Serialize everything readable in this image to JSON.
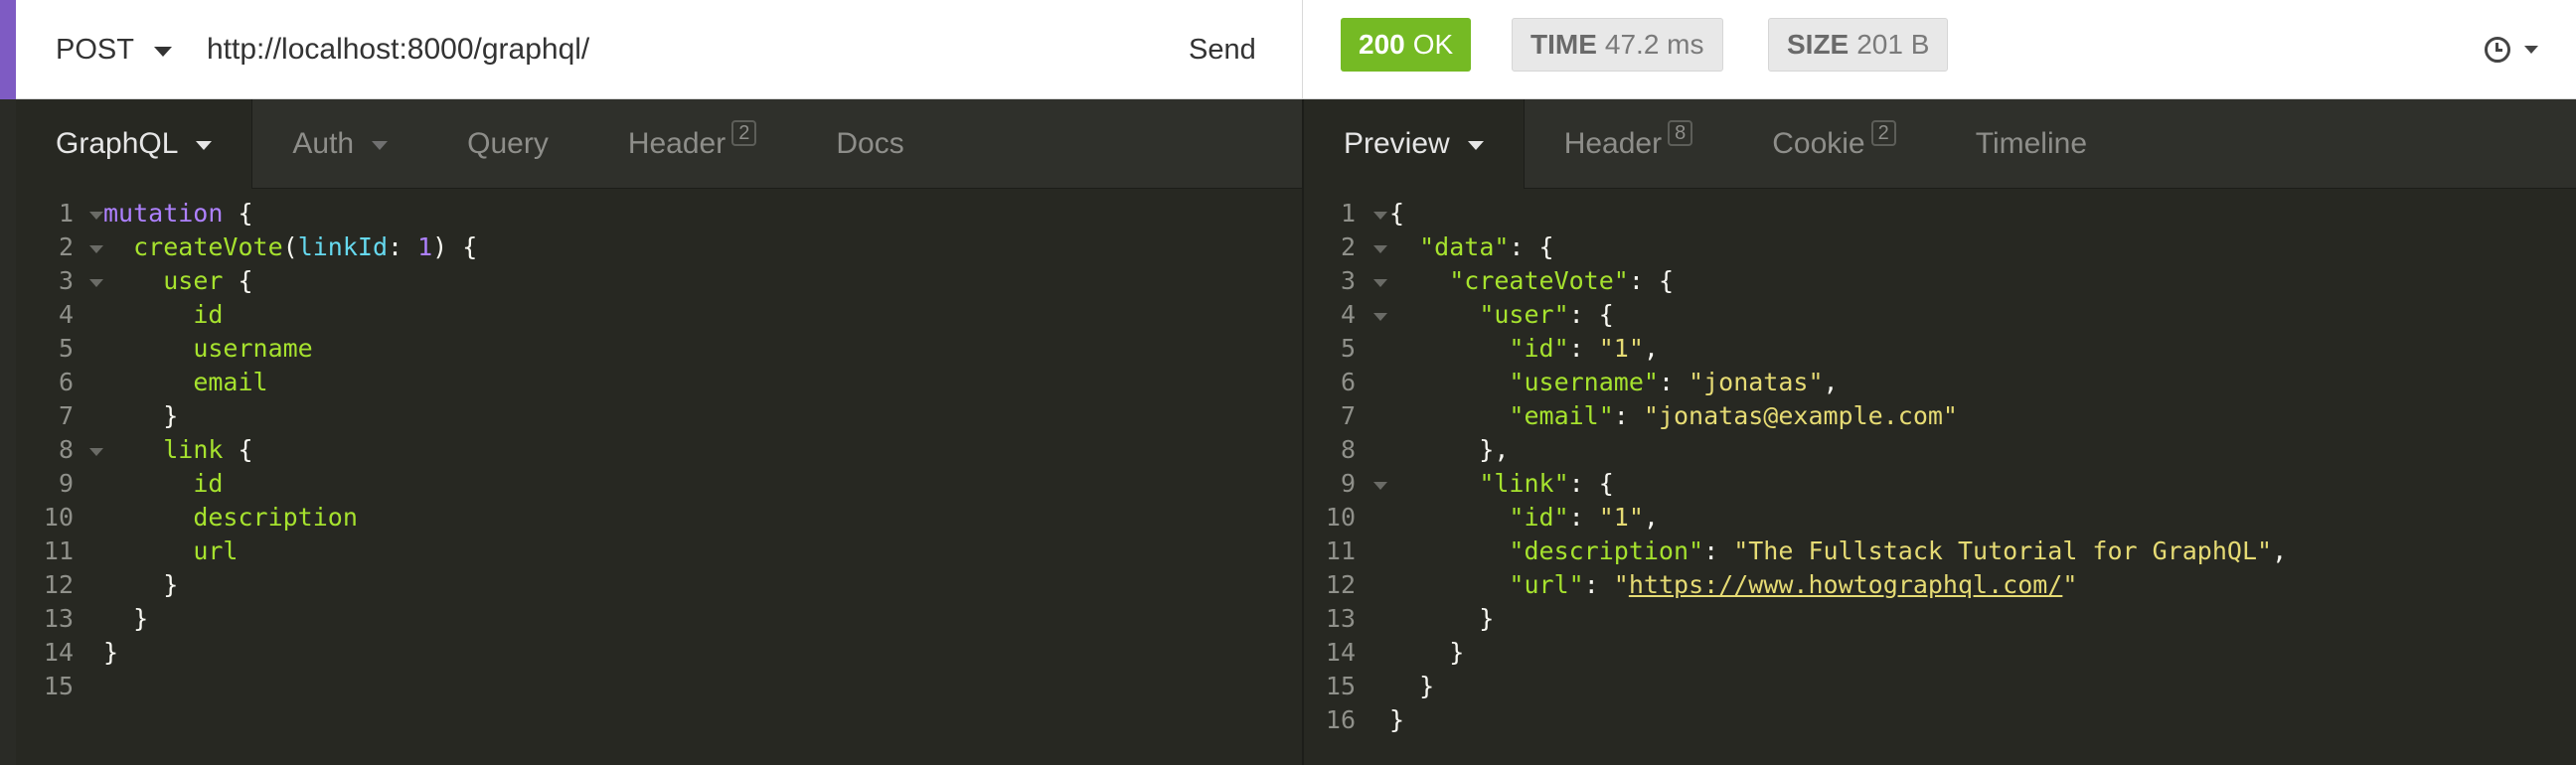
{
  "request": {
    "method": "POST",
    "url": "http://localhost:8000/graphql/",
    "send_label": "Send",
    "tabs": [
      {
        "label": "GraphQL",
        "caret": true,
        "active": true
      },
      {
        "label": "Auth",
        "caret": true
      },
      {
        "label": "Query"
      },
      {
        "label": "Header",
        "count": "2"
      },
      {
        "label": "Docs"
      }
    ],
    "code": [
      {
        "n": "1",
        "fold": true,
        "parts": [
          [
            "kw",
            "mutation"
          ],
          [
            "p",
            " {"
          ]
        ]
      },
      {
        "n": "2",
        "fold": true,
        "parts": [
          [
            "p",
            "  "
          ],
          [
            "fld",
            "createVote"
          ],
          [
            "p",
            "("
          ],
          [
            "arg",
            "linkId"
          ],
          [
            "p",
            ": "
          ],
          [
            "num",
            "1"
          ],
          [
            "p",
            ") {"
          ]
        ]
      },
      {
        "n": "3",
        "fold": true,
        "parts": [
          [
            "p",
            "    "
          ],
          [
            "fld",
            "user"
          ],
          [
            "p",
            " {"
          ]
        ]
      },
      {
        "n": "4",
        "parts": [
          [
            "p",
            "      "
          ],
          [
            "fld",
            "id"
          ]
        ]
      },
      {
        "n": "5",
        "parts": [
          [
            "p",
            "      "
          ],
          [
            "fld",
            "username"
          ]
        ]
      },
      {
        "n": "6",
        "parts": [
          [
            "p",
            "      "
          ],
          [
            "fld",
            "email"
          ]
        ]
      },
      {
        "n": "7",
        "parts": [
          [
            "p",
            "    }"
          ]
        ]
      },
      {
        "n": "8",
        "fold": true,
        "parts": [
          [
            "p",
            "    "
          ],
          [
            "fld",
            "link"
          ],
          [
            "p",
            " {"
          ]
        ]
      },
      {
        "n": "9",
        "parts": [
          [
            "p",
            "      "
          ],
          [
            "fld",
            "id"
          ]
        ]
      },
      {
        "n": "10",
        "parts": [
          [
            "p",
            "      "
          ],
          [
            "fld",
            "description"
          ]
        ]
      },
      {
        "n": "11",
        "parts": [
          [
            "p",
            "      "
          ],
          [
            "fld",
            "url"
          ]
        ]
      },
      {
        "n": "12",
        "parts": [
          [
            "p",
            "    }"
          ]
        ]
      },
      {
        "n": "13",
        "parts": [
          [
            "p",
            "  }"
          ]
        ]
      },
      {
        "n": "14",
        "parts": [
          [
            "p",
            "}"
          ]
        ]
      },
      {
        "n": "15",
        "parts": []
      }
    ]
  },
  "response": {
    "status_code": "200",
    "status_text": "OK",
    "time_label": "TIME",
    "time_value": "47.2 ms",
    "size_label": "SIZE",
    "size_value": "201 B",
    "history_icon": "clock-icon",
    "tabs": [
      {
        "label": "Preview",
        "caret": true,
        "active": true
      },
      {
        "label": "Header",
        "count": "8"
      },
      {
        "label": "Cookie",
        "count": "2"
      },
      {
        "label": "Timeline"
      }
    ],
    "code": [
      {
        "n": "1",
        "fold": true,
        "parts": [
          [
            "p",
            "{"
          ]
        ]
      },
      {
        "n": "2",
        "fold": true,
        "parts": [
          [
            "p",
            "  "
          ],
          [
            "jk",
            "\"data\""
          ],
          [
            "p",
            ": {"
          ]
        ]
      },
      {
        "n": "3",
        "fold": true,
        "parts": [
          [
            "p",
            "    "
          ],
          [
            "jk",
            "\"createVote\""
          ],
          [
            "p",
            ": {"
          ]
        ]
      },
      {
        "n": "4",
        "fold": true,
        "parts": [
          [
            "p",
            "      "
          ],
          [
            "jk",
            "\"user\""
          ],
          [
            "p",
            ": {"
          ]
        ]
      },
      {
        "n": "5",
        "parts": [
          [
            "p",
            "        "
          ],
          [
            "jk",
            "\"id\""
          ],
          [
            "p",
            ": "
          ],
          [
            "js",
            "\"1\""
          ],
          [
            "p",
            ","
          ]
        ]
      },
      {
        "n": "6",
        "parts": [
          [
            "p",
            "        "
          ],
          [
            "jk",
            "\"username\""
          ],
          [
            "p",
            ": "
          ],
          [
            "js",
            "\"jonatas\""
          ],
          [
            "p",
            ","
          ]
        ]
      },
      {
        "n": "7",
        "parts": [
          [
            "p",
            "        "
          ],
          [
            "jk",
            "\"email\""
          ],
          [
            "p",
            ": "
          ],
          [
            "js",
            "\"jonatas@example.com\""
          ]
        ]
      },
      {
        "n": "8",
        "parts": [
          [
            "p",
            "      },"
          ]
        ]
      },
      {
        "n": "9",
        "fold": true,
        "parts": [
          [
            "p",
            "      "
          ],
          [
            "jk",
            "\"link\""
          ],
          [
            "p",
            ": {"
          ]
        ]
      },
      {
        "n": "10",
        "parts": [
          [
            "p",
            "        "
          ],
          [
            "jk",
            "\"id\""
          ],
          [
            "p",
            ": "
          ],
          [
            "js",
            "\"1\""
          ],
          [
            "p",
            ","
          ]
        ]
      },
      {
        "n": "11",
        "parts": [
          [
            "p",
            "        "
          ],
          [
            "jk",
            "\"description\""
          ],
          [
            "p",
            ": "
          ],
          [
            "js",
            "\"The Fullstack Tutorial for GraphQL\""
          ],
          [
            "p",
            ","
          ]
        ]
      },
      {
        "n": "12",
        "parts": [
          [
            "p",
            "        "
          ],
          [
            "jk",
            "\"url\""
          ],
          [
            "p",
            ": "
          ],
          [
            "js",
            "\""
          ],
          [
            "jl",
            "https://www.howtographql.com/"
          ],
          [
            "js",
            "\""
          ]
        ]
      },
      {
        "n": "13",
        "parts": [
          [
            "p",
            "      }"
          ]
        ]
      },
      {
        "n": "14",
        "parts": [
          [
            "p",
            "    }"
          ]
        ]
      },
      {
        "n": "15",
        "parts": [
          [
            "p",
            "  }"
          ]
        ]
      },
      {
        "n": "16",
        "parts": [
          [
            "p",
            "}"
          ]
        ]
      }
    ]
  },
  "colors": {
    "accent": "#7e5bc3",
    "status_ok": "#75ba24",
    "editor_bg": "#272822",
    "keyword": "#ae81ff",
    "field": "#a6e22e",
    "argument": "#66d9ef",
    "string": "#e6db74"
  }
}
